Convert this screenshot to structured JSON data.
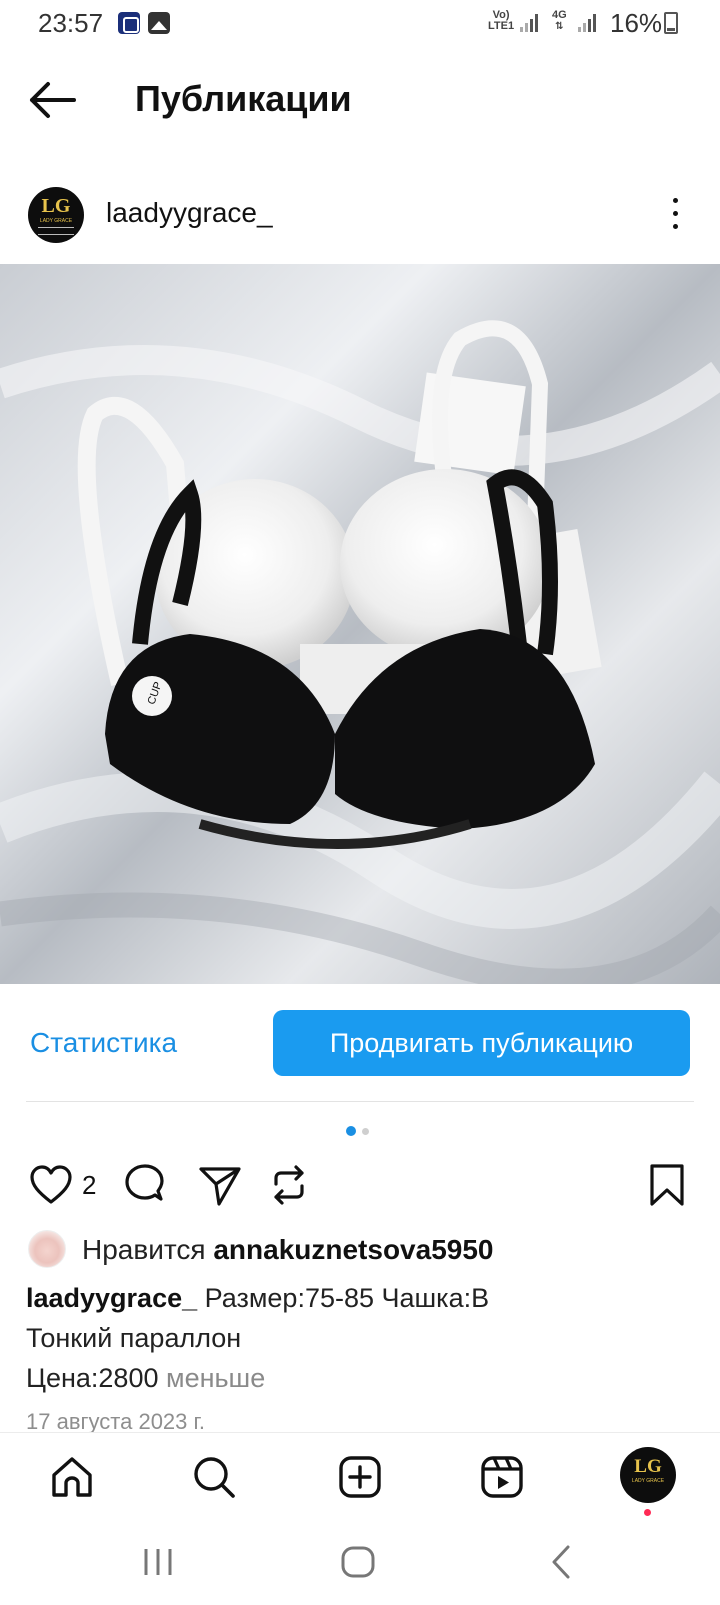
{
  "status_bar": {
    "time": "23:57",
    "network_top": "Vo)",
    "network_bottom": "LTE1",
    "network2_top": "4G",
    "battery": "16%"
  },
  "header": {
    "title": "Публикации"
  },
  "post": {
    "author": "laadyygrace_",
    "avatar_text": "LG",
    "avatar_sub": "LADY GRACE",
    "stats_label": "Статистика",
    "promote_label": "Продвигать публикацию",
    "like_count": "2",
    "likes_prefix": "Нравится",
    "liked_by": "annakuznetsova5950",
    "caption_user": "laadyygrace_",
    "caption_line1": "Размер:75-85 Чашка:В",
    "caption_line2": "Тонкий параллон",
    "caption_line3": "Цена:2800",
    "less_label": "меньше",
    "date": "17 августа 2023 г.",
    "carousel": {
      "count": 2,
      "active": 1
    }
  },
  "colors": {
    "accent": "#1a9bf0",
    "link": "#1a8fe3",
    "notification": "#ff2a55"
  },
  "icons": {
    "back": "arrow-left-icon",
    "more": "more-vertical-icon",
    "like": "heart-icon",
    "comment": "comment-icon",
    "share": "send-icon",
    "repost": "repost-icon",
    "save": "bookmark-icon",
    "home": "home-icon",
    "search": "search-icon",
    "create": "plus-square-icon",
    "reels": "reels-icon"
  }
}
